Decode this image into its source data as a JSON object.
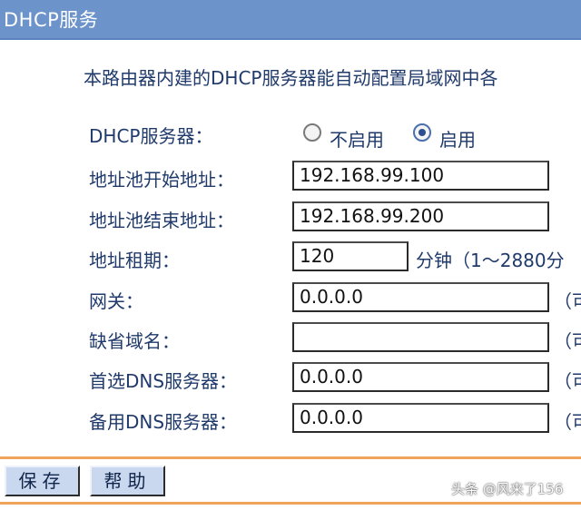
{
  "header": {
    "title": "DHCP服务"
  },
  "description": "本路由器内建的DHCP服务器能自动配置局域网中各",
  "form": {
    "dhcp_server": {
      "label": "DHCP服务器：",
      "options": [
        "不启用",
        "启用"
      ],
      "selected": "启用"
    },
    "pool_start": {
      "label": "地址池开始地址：",
      "value": "192.168.99.100"
    },
    "pool_end": {
      "label": "地址池结束地址：",
      "value": "192.168.99.200"
    },
    "lease": {
      "label": "地址租期：",
      "value": "120",
      "suffix": "分钟（1～2880分"
    },
    "gateway": {
      "label": "网关：",
      "value": "0.0.0.0",
      "suffix": "（可"
    },
    "domain": {
      "label": "缺省域名：",
      "value": "",
      "suffix": "（可"
    },
    "primary_dns": {
      "label": "首选DNS服务器：",
      "value": "0.0.0.0",
      "suffix": "（可"
    },
    "secondary_dns": {
      "label": "备用DNS服务器：",
      "value": "0.0.0.0",
      "suffix": "（可"
    }
  },
  "buttons": {
    "save": "保存",
    "help": "帮助"
  },
  "watermark": "头条 @风来了156",
  "colors": {
    "header_bg": "#6d93cb",
    "text": "#1f3a6b",
    "accent_line": "#f0a35a",
    "button_bg": "#c9d8ee"
  }
}
